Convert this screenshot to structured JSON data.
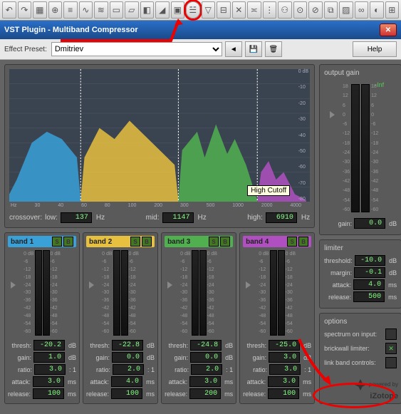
{
  "toolbar": {
    "icons": [
      "↶",
      "↷",
      "▦",
      "⊕",
      "≡",
      "∿",
      "≋",
      "▭",
      "▱",
      "◧",
      "◢",
      "▣",
      "☱",
      "▽",
      "⊟",
      "✕",
      "≍",
      "⋮",
      "⚇",
      "⊙",
      "⊘",
      "⧉",
      "▨",
      "∞",
      "◐",
      "⊞"
    ]
  },
  "window": {
    "title": "VST Plugin - Multiband Compressor"
  },
  "preset": {
    "label": "Effect Preset:",
    "value": "Dmitriev",
    "help": "Help"
  },
  "spectrum": {
    "tooltip": "High Cutoff",
    "xticks": [
      "Hz",
      "30",
      "40",
      "60",
      "80",
      "100",
      "200",
      "300",
      "500",
      "1000",
      "2000",
      "4000"
    ],
    "yticks": [
      "0 dB",
      "-10",
      "-20",
      "-30",
      "-40",
      "-50",
      "-60",
      "-70",
      "-80"
    ],
    "crossover_label": "crossover:",
    "low": {
      "label": "low:",
      "value": "137",
      "unit": "Hz"
    },
    "mid": {
      "label": "mid:",
      "value": "1147",
      "unit": "Hz"
    },
    "high": {
      "label": "high:",
      "value": "6910",
      "unit": "Hz"
    }
  },
  "band_scale": [
    "0 dB",
    "-6",
    "-12",
    "-18",
    "-24",
    "-30",
    "-36",
    "-42",
    "-48",
    "-54",
    "-60"
  ],
  "bands": [
    {
      "name": "band 1",
      "thresh": "-20.2",
      "gain": "1.0",
      "ratio": "3.0",
      "attack": "3.0",
      "release": "100"
    },
    {
      "name": "band 2",
      "thresh": "-22.8",
      "gain": "0.0",
      "ratio": "2.0",
      "attack": "4.0",
      "release": "100"
    },
    {
      "name": "band 3",
      "thresh": "-24.8",
      "gain": "0.0",
      "ratio": "2.0",
      "attack": "3.0",
      "release": "200"
    },
    {
      "name": "band 4",
      "thresh": "-25.0",
      "gain": "3.0",
      "ratio": "3.0",
      "attack": "3.0",
      "release": "100"
    }
  ],
  "labels": {
    "thresh": "thresh:",
    "gain": "gain:",
    "ratio": "ratio:",
    "attack": "attack:",
    "release": "release:",
    "db": "dB",
    "ms": "ms",
    "r": ": 1",
    "margin": "margin:",
    "threshold": "threshold:"
  },
  "output": {
    "title": "output gain",
    "inf": "-Inf",
    "scale": [
      "18",
      "12",
      "6",
      "0",
      "-6",
      "-12",
      "-18",
      "-24",
      "-30",
      "-36",
      "-42",
      "-48",
      "-54",
      "-60"
    ],
    "gain_label": "gain:",
    "gain": "0.0"
  },
  "limiter": {
    "title": "limiter",
    "threshold": "-10.0",
    "margin": "-0.1",
    "attack": "4.0",
    "release": "500"
  },
  "options": {
    "title": "options",
    "spectrum": "spectrum on input:",
    "brickwall": "brickwall limiter:",
    "link": "link band controls:",
    "brickwall_on": "✕"
  },
  "logo": {
    "powered": "powered by",
    "brand": "iZotope"
  }
}
